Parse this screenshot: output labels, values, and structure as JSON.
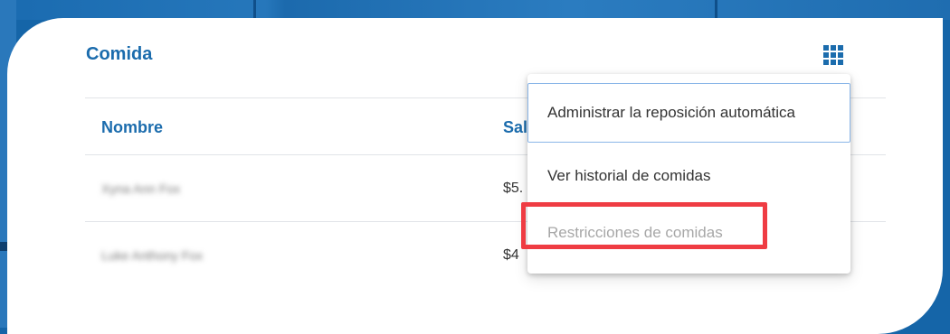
{
  "card": {
    "title": "Comida"
  },
  "table": {
    "columns": [
      "Nombre",
      "Sal"
    ],
    "rows": [
      {
        "name": "Xyna Ann Fox",
        "balance": "$5."
      },
      {
        "name": "Luke Anthony Fox",
        "balance": "$4"
      }
    ]
  },
  "menu": {
    "items": [
      {
        "label": "Administrar la reposición automática",
        "state": "focused"
      },
      {
        "label": "Ver historial de comidas",
        "state": "enabled"
      },
      {
        "label": "Restricciones de comidas",
        "state": "disabled"
      }
    ]
  },
  "icons": {
    "menu_toggle": "grid-icon"
  },
  "colors": {
    "brand": "#1b6cad",
    "background": "#1565a8",
    "highlight": "#ef3c43",
    "disabled_text": "#a7a7a7",
    "focus_border": "#8ab6e8"
  }
}
